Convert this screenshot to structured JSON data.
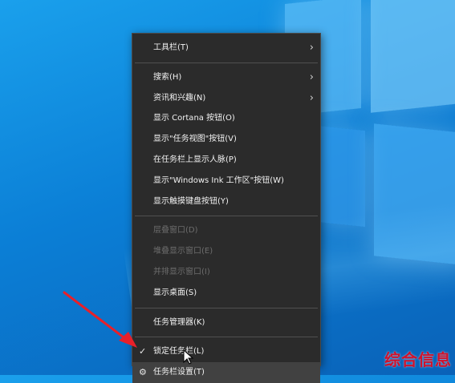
{
  "menu": {
    "items": [
      {
        "label": "工具栏(T)",
        "has_submenu": true
      },
      {
        "label": "搜索(H)",
        "has_submenu": true
      },
      {
        "label": "资讯和兴趣(N)",
        "has_submenu": true
      },
      {
        "label": "显示 Cortana 按钮(O)"
      },
      {
        "label": "显示\"任务视图\"按钮(V)"
      },
      {
        "label": "在任务栏上显示人脉(P)"
      },
      {
        "label": "显示\"Windows Ink 工作区\"按钮(W)"
      },
      {
        "label": "显示触摸键盘按钮(Y)"
      },
      {
        "label": "层叠窗口(D)",
        "disabled": true
      },
      {
        "label": "堆叠显示窗口(E)",
        "disabled": true
      },
      {
        "label": "并排显示窗口(I)",
        "disabled": true
      },
      {
        "label": "显示桌面(S)"
      },
      {
        "label": "任务管理器(K)"
      },
      {
        "label": "锁定任务栏(L)",
        "checked": true
      },
      {
        "label": "任务栏设置(T)",
        "highlighted": true
      }
    ]
  },
  "icons": {
    "submenu": "chevron-right-icon",
    "check": "checkmark-icon",
    "settings": "gear-icon"
  },
  "watermark": "综合信息",
  "colors": {
    "desktop": "#0b7fd6",
    "menu_bg": "#2b2b2b",
    "menu_text": "#f2f2f2",
    "disabled_text": "#6d6d6d",
    "highlight": "#414141",
    "annotation_arrow": "#e8202a",
    "watermark": "#d0122b"
  }
}
